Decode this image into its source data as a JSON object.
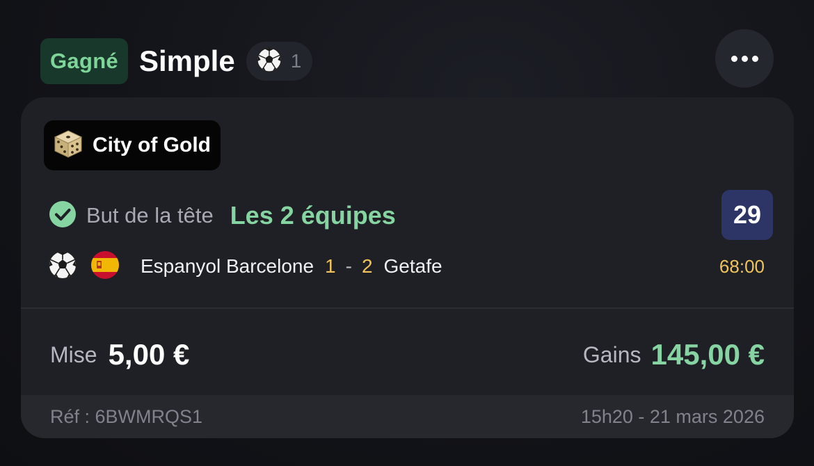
{
  "header": {
    "status": "Gagné",
    "bet_type": "Simple",
    "sport_count": "1",
    "icons": {
      "sport": "soccer-ball-icon",
      "more": "more-dots-icon"
    }
  },
  "card": {
    "game_chip": {
      "label": "City of Gold",
      "icon": "dice-icon"
    },
    "selection": {
      "market": "But de la tête",
      "pick": "Les 2 équipes",
      "odds": "29",
      "status_icon": "check-circle-icon"
    },
    "match": {
      "home_team": "Espanyol Barcelone",
      "home_score": "1",
      "separator": "-",
      "away_score": "2",
      "away_team": "Getafe",
      "time": "68:00",
      "country_flag": "spain-flag-icon"
    },
    "stake": {
      "label": "Mise",
      "value": "5,00 €"
    },
    "gains": {
      "label": "Gains",
      "value": "145,00 €"
    },
    "footer": {
      "ref": "Réf : 6BWMRQS1",
      "datetime": "15h20 - 21 mars 2026"
    }
  },
  "colors": {
    "win_green": "#86d4a2",
    "badge_bg": "#17382a",
    "odds_bg": "#2d3566",
    "score_yellow": "#f0c45a"
  }
}
